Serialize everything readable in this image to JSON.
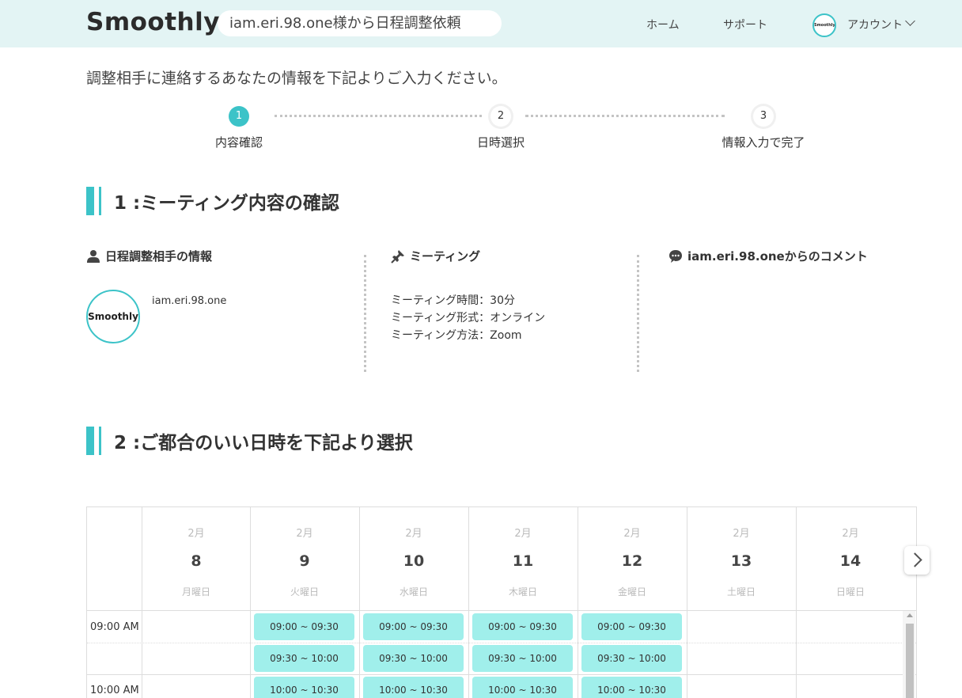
{
  "header": {
    "logo": "Smoothly",
    "request_title": "iam.eri.98.one様から日程調整依頼",
    "nav": {
      "home": "ホーム",
      "support": "サポート",
      "account": "アカウント"
    },
    "avatar_text": "Smoothly"
  },
  "instruction": "調整相手に連絡するあなたの情報を下記よりご入力ください。",
  "steps": [
    {
      "number": "1",
      "label": "内容確認"
    },
    {
      "number": "2",
      "label": "日時選択"
    },
    {
      "number": "3",
      "label": "情報入力で完了"
    }
  ],
  "section1": {
    "title": "1 :ミーティング内容の確認",
    "partner_heading": "日程調整相手の情報",
    "partner_avatar_text": "Smoothly",
    "partner_name": "iam.eri.98.one",
    "meeting_heading": "ミーティング",
    "meeting_lines": [
      "ミーティング時間：30分",
      "ミーティング形式：オンライン",
      "ミーティング方法：Zoom"
    ],
    "comment_heading": "iam.eri.98.oneからのコメント"
  },
  "section2": {
    "title": "2 :ご都合のいい日時を下記より選択"
  },
  "calendar": {
    "days": [
      {
        "month": "2月",
        "date": "8",
        "weekday": "月曜日"
      },
      {
        "month": "2月",
        "date": "9",
        "weekday": "火曜日"
      },
      {
        "month": "2月",
        "date": "10",
        "weekday": "水曜日"
      },
      {
        "month": "2月",
        "date": "11",
        "weekday": "木曜日"
      },
      {
        "month": "2月",
        "date": "12",
        "weekday": "金曜日"
      },
      {
        "month": "2月",
        "date": "13",
        "weekday": "土曜日"
      },
      {
        "month": "2月",
        "date": "14",
        "weekday": "日曜日"
      }
    ],
    "time_labels": [
      "09:00 AM",
      "10:00 AM"
    ],
    "slot_labels": [
      "09:00 ~ 09:30",
      "09:30 ~ 10:00",
      "10:00 ~ 10:30"
    ],
    "slot_color": "#a0efeb",
    "accent_color": "#3cc3c8"
  }
}
